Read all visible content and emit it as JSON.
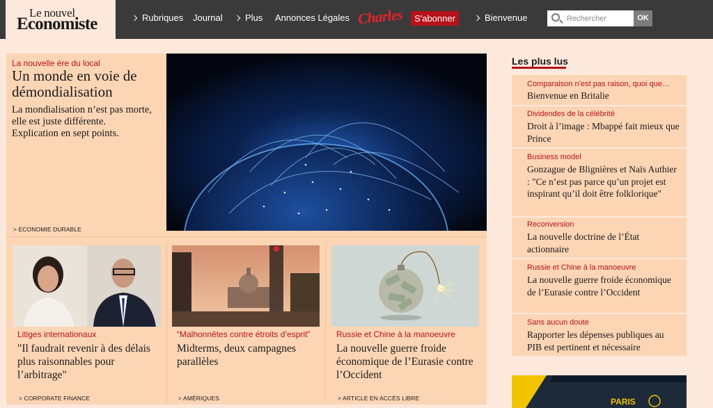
{
  "nav": {
    "logo_line1": "Le nouvel",
    "logo_line2": "Economiste",
    "rubriques": "Rubriques",
    "journal": "Journal",
    "plus": "Plus",
    "annonces": "Annonces Légales",
    "charles": "Charles",
    "subscribe": "S'abonner",
    "bienvenue": "Bienvenue",
    "search_placeholder": "Rechercher",
    "ok": "OK"
  },
  "hero": {
    "kicker": "La nouvelle ère du local",
    "title": "Un monde en voie de démondialisation",
    "description": "La mondialisation n’est pas morte, elle est juste différente. Explication en sept points.",
    "rubric": "> ECONOMIE DURABLE"
  },
  "cards": [
    {
      "kicker": "Litiges internationaux",
      "title": "\"Il faudrait revenir à des délais plus raisonnables pour l’arbitrage\"",
      "rubric": "> CORPORATE FINANCE"
    },
    {
      "kicker": "“Malhonnêtes contre étroits d’esprit”",
      "title": "Midterms, deux campagnes parallèles",
      "rubric": "> AMÉRIQUES"
    },
    {
      "kicker": "Russie et Chine à la manoeuvre",
      "title": "La nouvelle guerre froide économique de l’Eurasie contre l’Occident",
      "rubric": "> ARTICLE EN ACCÈS LIBRE"
    }
  ],
  "sidebar": {
    "heading": "Les plus lus",
    "items": [
      {
        "kicker": "Comparaison n’est pas raison, quoi que…",
        "title": "Bienvenue en Britalie"
      },
      {
        "kicker": "Dividendes de la célébrité",
        "title": "Droit à l’image : Mbappé fait mieux que Prince"
      },
      {
        "kicker": "Business model",
        "title": "Gonzague de Blignières et Naïs Authier : \"Ce n’est pas parce qu’un projet est inspirant qu’il doit être folklorique\""
      },
      {
        "kicker": "Reconversion",
        "title": "La nouvelle doctrine de l’État actionnaire"
      },
      {
        "kicker": "Russie et Chine à la manoeuvre",
        "title": "La nouvelle guerre froide économique de l’Eurasie contre l’Occident"
      },
      {
        "kicker": "Sans aucun doute",
        "title": "Rapporter les dépenses publiques au PIB est pertinent et nécessaire"
      }
    ],
    "ad_text": "PARIS"
  },
  "colors": {
    "brand_red": "#b5121b",
    "nav_bg": "#3a3a3a",
    "page_bg": "#fde9dc",
    "card_bg": "#fcd5b5"
  }
}
